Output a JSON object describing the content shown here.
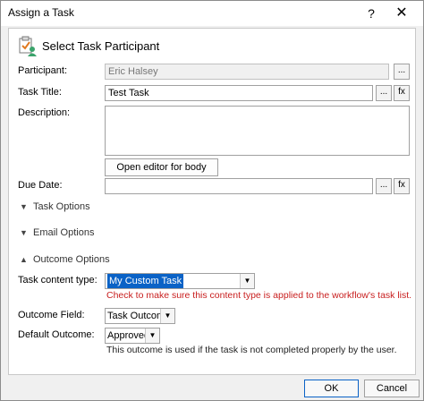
{
  "window": {
    "title": "Assign a Task",
    "help": "?",
    "close": "✕"
  },
  "header": {
    "title": "Select Task Participant",
    "icon": "task-clipboard-icon"
  },
  "participant": {
    "label": "Participant:",
    "value": "Eric Halsey",
    "browse": "..."
  },
  "task_title": {
    "label": "Task Title:",
    "value": "Test Task",
    "browse": "...",
    "fx": "fx"
  },
  "description": {
    "label": "Description:",
    "value": "",
    "editor_button": "Open editor for body"
  },
  "due_date": {
    "label": "Due Date:",
    "value": "",
    "browse": "...",
    "fx": "fx"
  },
  "sections": {
    "task_options": {
      "label": "Task Options",
      "chevron": "▼"
    },
    "email_options": {
      "label": "Email Options",
      "chevron": "▼"
    },
    "outcome_options": {
      "label": "Outcome Options",
      "chevron": "▲"
    }
  },
  "task_content_type": {
    "label": "Task content type:",
    "value": "My Custom Task",
    "warning": "Check to make sure this content type is applied to the workflow's task list."
  },
  "outcome_field": {
    "label": "Outcome Field:",
    "value": "Task Outcome"
  },
  "default_outcome": {
    "label": "Default Outcome:",
    "value": "Approved",
    "note": "This outcome is used if the task is not completed properly by the user."
  },
  "footer": {
    "ok": "OK",
    "cancel": "Cancel"
  },
  "colors": {
    "accent": "#0a62c6",
    "warning": "#c81e1e"
  }
}
